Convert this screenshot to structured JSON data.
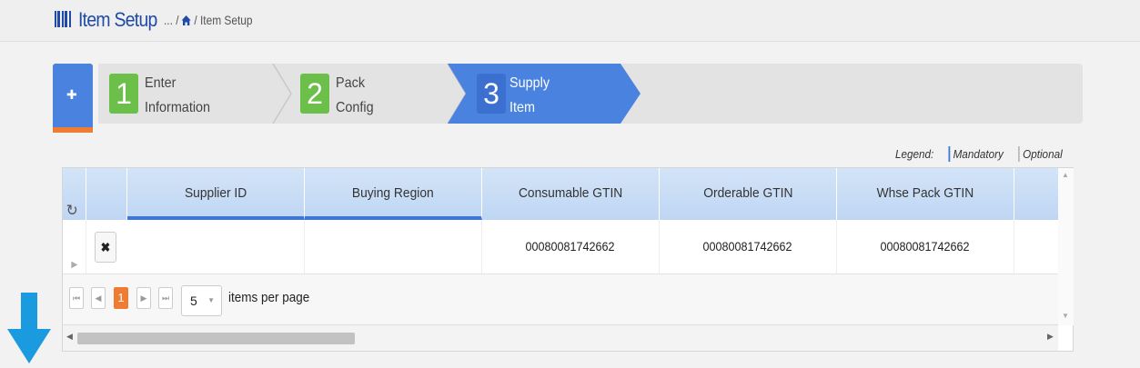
{
  "header": {
    "title": "Item Setup",
    "breadcrumb_prefix": "... /",
    "breadcrumb_current": "/ Item Setup"
  },
  "wizard": {
    "steps": [
      {
        "number": "1",
        "line1": "Enter",
        "line2": "Information",
        "state": "done"
      },
      {
        "number": "2",
        "line1": "Pack",
        "line2": "Config",
        "state": "done"
      },
      {
        "number": "3",
        "line1": "Supply",
        "line2": "Item",
        "state": "active"
      }
    ]
  },
  "legend": {
    "label": "Legend:",
    "mandatory": "Mandatory",
    "optional": "Optional"
  },
  "grid": {
    "columns": [
      "Supplier ID",
      "Buying Region",
      "Consumable GTIN",
      "Orderable GTIN",
      "Whse Pack GTIN"
    ],
    "rows": [
      {
        "supplier_id": "",
        "buying_region": "",
        "consumable_gtin": "00080081742662",
        "orderable_gtin": "00080081742662",
        "whse_pack_gtin": "00080081742662"
      }
    ],
    "pager": {
      "current_page": "1",
      "page_size": "5",
      "items_per_page_label": "items per page"
    }
  },
  "colors": {
    "brand_blue": "#1f4aa6",
    "step_done": "#6cc04a",
    "step_active": "#4a82e0",
    "accent_orange": "#f07c33",
    "scroll_arrow": "#1a9be0"
  },
  "icons": [
    "barcode-icon",
    "home-icon",
    "puzzle-icon",
    "refresh-icon",
    "expand-row-icon",
    "delete-icon",
    "first-page-icon",
    "prev-page-icon",
    "next-page-icon",
    "last-page-icon",
    "scroll-down-arrow-icon"
  ]
}
